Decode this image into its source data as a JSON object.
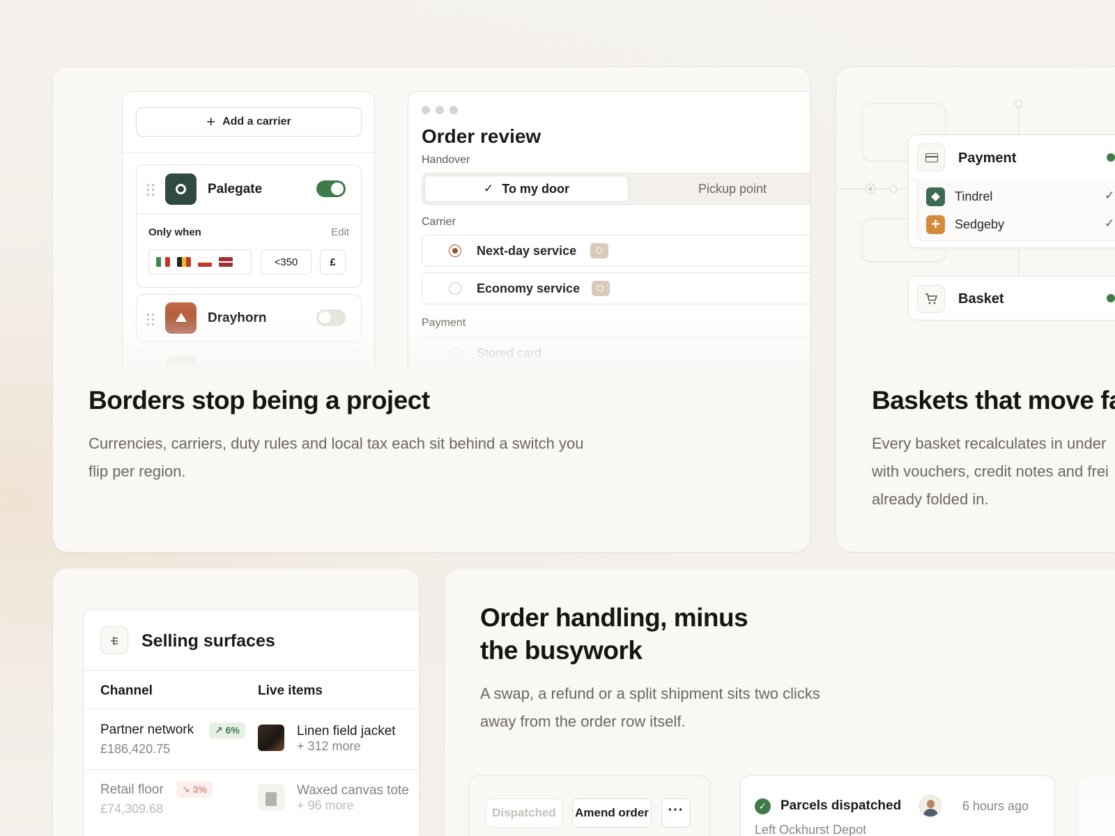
{
  "card1": {
    "carriers": {
      "add_label": "Add a carrier",
      "items": [
        {
          "name": "Palegate",
          "enabled": true
        },
        {
          "name": "Drayhorn",
          "enabled": false
        }
      ],
      "only_when_label": "Only when",
      "edit_label": "Edit",
      "threshold": "<350",
      "currency": "£"
    },
    "order_review": {
      "title": "Order review",
      "handover_label": "Handover",
      "handover_options": [
        "To my door",
        "Pickup point"
      ],
      "carrier_label": "Carrier",
      "services": [
        {
          "name": "Next-day service",
          "selected": true
        },
        {
          "name": "Economy service",
          "selected": false
        }
      ],
      "payment_label": "Payment",
      "payment_option": "Stored card"
    },
    "headline": "Borders stop being a project",
    "body": "Currencies, carriers, duty rules and local tax each sit behind a switch you flip per region."
  },
  "card2": {
    "payment_title": "Payment",
    "providers": [
      {
        "name": "Tindrel",
        "color": "#3d6b55"
      },
      {
        "name": "Sedgeby",
        "color": "#d48a3a"
      }
    ],
    "basket_title": "Basket",
    "headline": "Baskets that move fa",
    "body": "Every basket recalculates in under with vouchers, credit notes and frei already folded in."
  },
  "card3": {
    "title": "Selling surfaces",
    "col_channel": "Channel",
    "col_items": "Live items",
    "rows": [
      {
        "channel": "Partner network",
        "change": "6%",
        "trend": "up",
        "amount": "£186,420.75",
        "item": "Linen field jacket",
        "more": "+ 312 more"
      },
      {
        "channel": "Retail floor",
        "change": "3%",
        "trend": "down",
        "amount": "£74,309.68",
        "item": "Waxed canvas tote",
        "more": "+ 96 more"
      }
    ]
  },
  "card4": {
    "headline_line1": "Order handling, minus",
    "headline_line2": "the busywork",
    "body_line1": "A swap, a refund or a split shipment sits two clicks",
    "body_line2": "away from the order row itself.",
    "status_chip": "Dispatched",
    "amend_label": "Amend order",
    "event_title": "Parcels dispatched",
    "event_time": "6 hours ago",
    "event_sub": "Left Ockhurst Depot"
  },
  "colors": {
    "accent_green": "#3f7a4a",
    "accent_brown": "#a0522d",
    "palegate": "#2f4a3e",
    "drayhorn": "#b2573a"
  }
}
